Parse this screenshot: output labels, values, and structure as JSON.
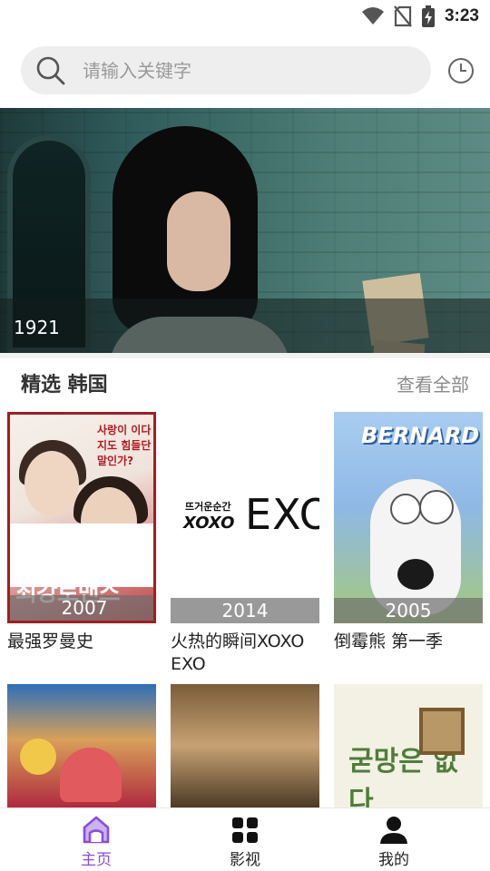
{
  "status_bar": {
    "time": "3:23"
  },
  "search": {
    "placeholder": "请输入关键字"
  },
  "banner": {
    "caption": "1921"
  },
  "section": {
    "title": "精选 韩国",
    "view_all": "查看全部"
  },
  "cards": [
    {
      "title": "最强罗曼史",
      "year": "2007"
    },
    {
      "title": "火热的瞬间XOXO EXO",
      "year": "2014"
    },
    {
      "title": "倒霉熊 第一季",
      "year": "2005"
    },
    {
      "title": "",
      "year": ""
    },
    {
      "title": "",
      "year": ""
    },
    {
      "title": "",
      "year": ""
    }
  ],
  "posters": {
    "p1_top": "사랑이 이다지도 힘들단 말인가?",
    "p1_title": "최강로맨스",
    "p2_small": "뜨거운순간",
    "p2_xoxo": "XOXO",
    "p2_logo": "EXO",
    "p3_brand": "BERNARD",
    "p6_title": "굳망은 없다"
  },
  "nav": [
    {
      "label": "主页",
      "icon": "home-icon",
      "active": true
    },
    {
      "label": "影视",
      "icon": "grid-icon",
      "active": false
    },
    {
      "label": "我的",
      "icon": "person-icon",
      "active": false
    }
  ],
  "colors": {
    "accent": "#8a4de0",
    "view_all": "#8a8a8a"
  }
}
